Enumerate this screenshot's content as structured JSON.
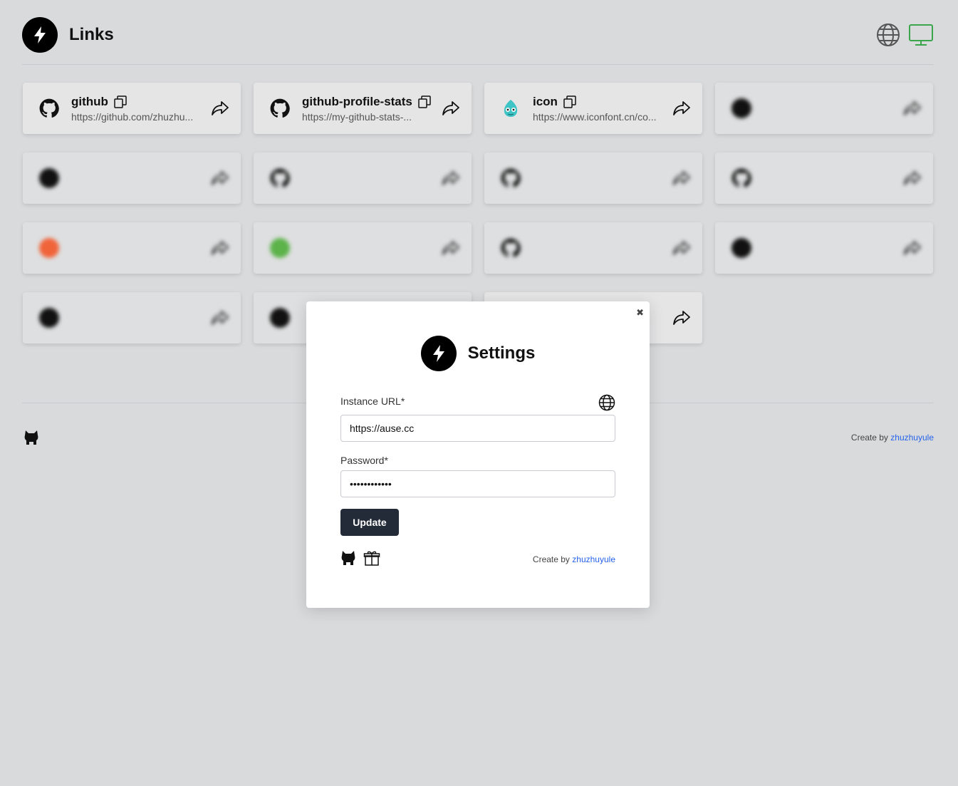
{
  "header": {
    "title": "Links",
    "language_icon": "globe-icon",
    "display_icon": "monitor-icon",
    "display_icon_color": "#3aa54a"
  },
  "cards": [
    {
      "title": "github",
      "url": "https://github.com/zhuzhu...",
      "icon": "github-icon",
      "blurred": false
    },
    {
      "title": "github-profile-stats",
      "url": "https://my-github-stats-...",
      "icon": "github-icon",
      "blurred": false
    },
    {
      "title": "icon",
      "url": "https://www.iconfont.cn/co...",
      "icon": "iconfont-chameleon-icon",
      "blurred": false
    },
    {
      "title": "",
      "url": "",
      "icon": "dark-circle-icon",
      "blurred": true
    },
    {
      "title": "",
      "url": "",
      "icon": "dark-circle-icon",
      "blurred": true
    },
    {
      "title": "",
      "url": "",
      "icon": "github-icon",
      "blurred": true
    },
    {
      "title": "",
      "url": "",
      "icon": "github-icon",
      "blurred": true
    },
    {
      "title": "",
      "url": "",
      "icon": "github-icon",
      "blurred": true
    },
    {
      "title": "",
      "url": "",
      "icon": "orange-circle-icon",
      "blurred": true
    },
    {
      "title": "",
      "url": "",
      "icon": "green-circle-icon",
      "blurred": true
    },
    {
      "title": "",
      "url": "",
      "icon": "github-icon",
      "blurred": true
    },
    {
      "title": "",
      "url": "",
      "icon": "dark-circle-icon",
      "blurred": true
    },
    {
      "title": "",
      "url": "",
      "icon": "dark-circle-icon",
      "blurred": true
    },
    {
      "title": "",
      "url": "",
      "icon": "dark-circle-icon",
      "blurred": true
    },
    {
      "title": "",
      "url": "",
      "icon": "blank-icon",
      "blurred": false
    }
  ],
  "footer": {
    "credit_prefix": "Create by",
    "credit_author": "zhuzhuyule"
  },
  "modal": {
    "title": "Settings",
    "close_label": "✖",
    "instance_url_label": "Instance URL*",
    "instance_url_value": "https://ause.cc",
    "password_label": "Password*",
    "password_value": "••••••••••••",
    "update_label": "Update",
    "credit_prefix": "Create by",
    "credit_author": "zhuzhuyule"
  }
}
